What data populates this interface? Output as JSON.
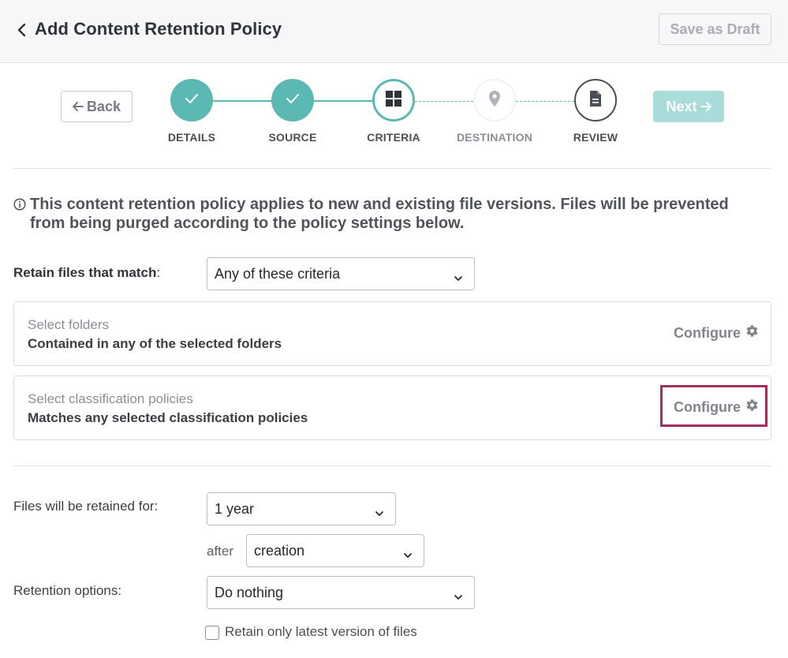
{
  "header": {
    "title": "Add Content Retention Policy",
    "save_draft_label": "Save as Draft"
  },
  "stepper": {
    "back_label": "Back",
    "next_label": "Next",
    "steps": [
      {
        "label": "DETAILS",
        "state": "complete",
        "icon": "check-icon"
      },
      {
        "label": "SOURCE",
        "state": "complete",
        "icon": "check-icon"
      },
      {
        "label": "CRITERIA",
        "state": "current",
        "icon": "grid-icon"
      },
      {
        "label": "DESTINATION",
        "state": "upcoming",
        "icon": "location-pin-icon"
      },
      {
        "label": "REVIEW",
        "state": "upcoming",
        "icon": "document-icon"
      }
    ]
  },
  "info": {
    "icon": "info-icon",
    "line1": "This content retention policy applies to new and existing file versions. Files will be prevented",
    "line2": "from being purged according to the policy settings below."
  },
  "criteria": {
    "match_label": "Retain files that match",
    "match_colon": ":",
    "match_value": "Any of these criteria",
    "cards": [
      {
        "subtitle": "Select folders",
        "title": "Contained in any of the selected folders",
        "action": "Configure"
      },
      {
        "subtitle": "Select classification policies",
        "title": "Matches any selected classification policies",
        "action": "Configure"
      }
    ]
  },
  "retention": {
    "period_label": "Files will be retained for:",
    "period_value": "1 year",
    "after_label": "after",
    "after_value": "creation",
    "options_label": "Retention options:",
    "options_value": "Do nothing",
    "latest_version_label": "Retain only latest version of files",
    "latest_version_checked": false
  },
  "colors": {
    "accent": "#5bb8b2",
    "next_disabled": "#a7dcd9",
    "highlight": "#a1305e"
  }
}
